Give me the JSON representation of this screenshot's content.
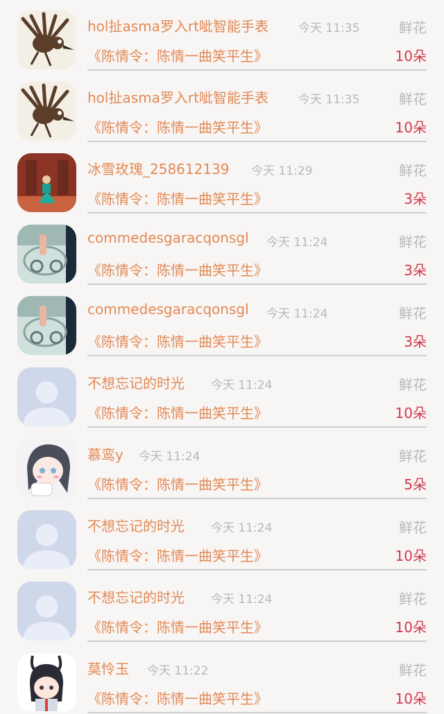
{
  "items": [
    {
      "avatar_icon": "bird-drawing-avatar",
      "name": "hol扯asma罗入rt呲智能手表",
      "time": "今天 11:35",
      "gift": "鲜花",
      "work": "《陈情令：陈情一曲笑平生》",
      "count": "10朵"
    },
    {
      "avatar_icon": "bird-drawing-avatar",
      "name": "hol扯asma罗入rt呲智能手表",
      "time": "今天 11:35",
      "gift": "鲜花",
      "work": "《陈情令：陈情一曲笑平生》",
      "count": "10朵"
    },
    {
      "avatar_icon": "girl-photo-avatar",
      "name": "冰雪玫瑰_258612139",
      "time": "今天 11:29",
      "gift": "鲜花",
      "work": "《陈情令：陈情一曲笑平生》",
      "count": "3朵"
    },
    {
      "avatar_icon": "glass-figure-avatar",
      "name": "commedesgaracqonsgl",
      "time": "今天 11:24",
      "gift": "鲜花",
      "work": "《陈情令：陈情一曲笑平生》",
      "count": "3朵"
    },
    {
      "avatar_icon": "glass-figure-avatar",
      "name": "commedesgaracqonsgl",
      "time": "今天 11:24",
      "gift": "鲜花",
      "work": "《陈情令：陈情一曲笑平生》",
      "count": "3朵"
    },
    {
      "avatar_icon": "default-user-avatar",
      "name": "不想忘记的时光",
      "time": "今天 11:24",
      "gift": "鲜花",
      "work": "《陈情令：陈情一曲笑平生》",
      "count": "10朵"
    },
    {
      "avatar_icon": "anime-girl-avatar",
      "name": "慕鸾y",
      "time": "今天 11:24",
      "gift": "鲜花",
      "work": "《陈情令：陈情一曲笑平生》",
      "count": "5朵"
    },
    {
      "avatar_icon": "default-user-avatar",
      "name": "不想忘记的时光",
      "time": "今天 11:24",
      "gift": "鲜花",
      "work": "《陈情令：陈情一曲笑平生》",
      "count": "10朵"
    },
    {
      "avatar_icon": "default-user-avatar",
      "name": "不想忘记的时光",
      "time": "今天 11:24",
      "gift": "鲜花",
      "work": "《陈情令：陈情一曲笑平生》",
      "count": "10朵"
    },
    {
      "avatar_icon": "chibi-character-avatar",
      "name": "莫怜玉",
      "time": "今天 11:22",
      "gift": "鲜花",
      "work": "《陈情令：陈情一曲笑平生》",
      "count": "10朵"
    }
  ],
  "colors": {
    "name": "#e28a55",
    "muted": "#b8b8b8",
    "count": "#d2374b",
    "background": "#f8f5f5"
  }
}
